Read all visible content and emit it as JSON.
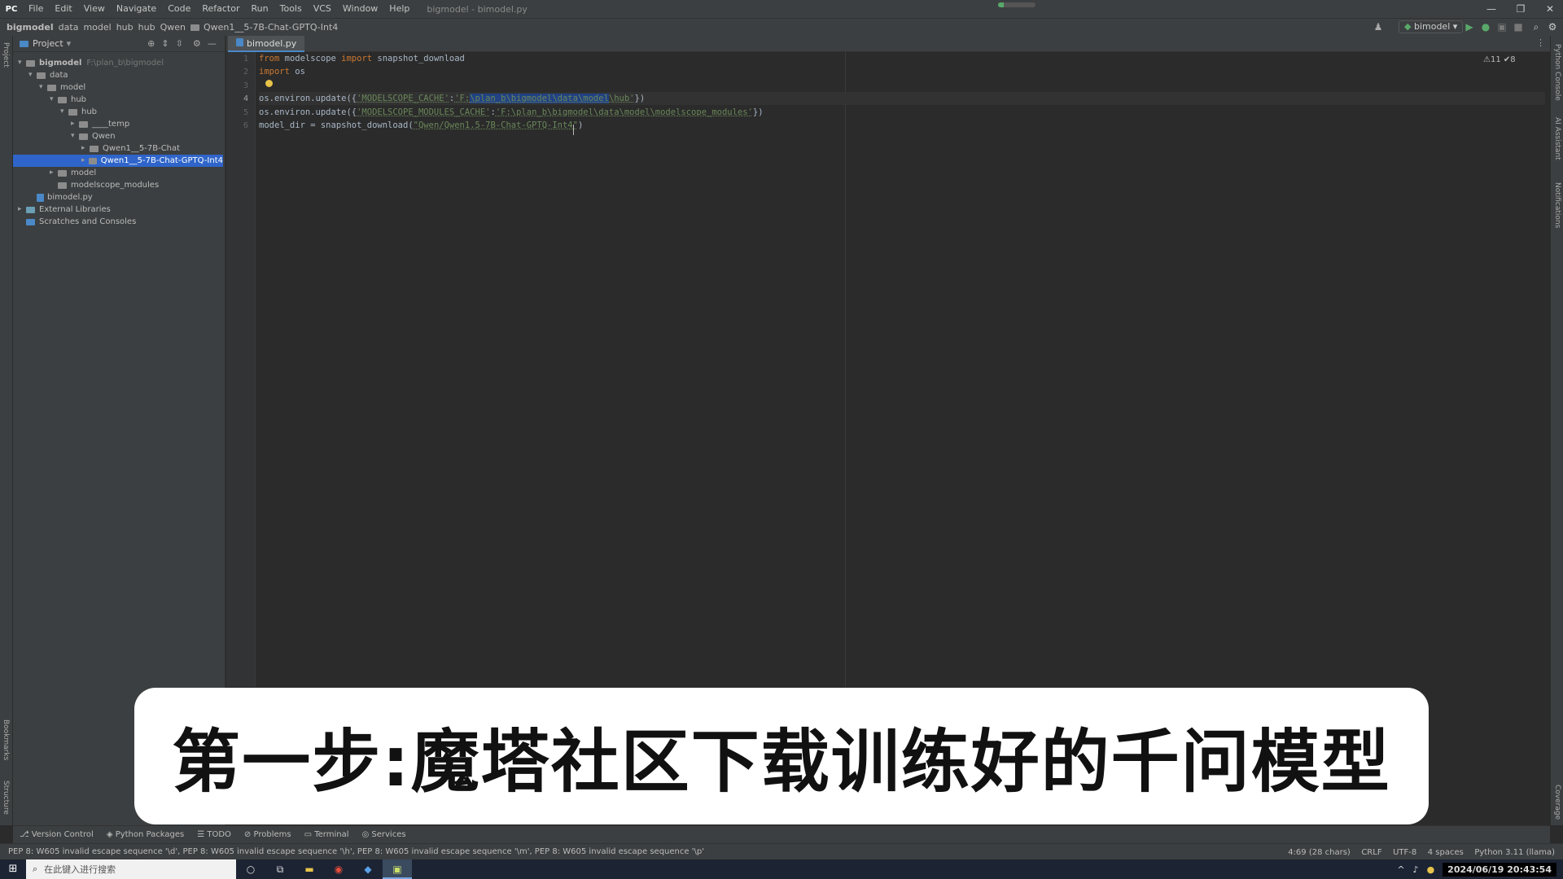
{
  "window": {
    "app_icon": "pycharm-icon",
    "menu": [
      "File",
      "Edit",
      "View",
      "Navigate",
      "Code",
      "Refactor",
      "Run",
      "Tools",
      "VCS",
      "Window",
      "Help"
    ],
    "title": "bigmodel - bimodel.py",
    "progress_fraction": 0.15,
    "controls": [
      "—",
      "❐",
      "✕"
    ]
  },
  "navbar": {
    "breadcrumb": [
      "bigmodel",
      "data",
      "model",
      "hub",
      "hub",
      "Qwen",
      "Qwen1__5-7B-Chat-GPTQ-Int4"
    ],
    "run_config": "bimodel"
  },
  "left_strip": {
    "top": [
      "Project"
    ],
    "bottom": [
      "Bookmarks",
      "Structure"
    ]
  },
  "right_strip": {
    "top": [
      "Python Console",
      "AI Assistant",
      "Notifications"
    ],
    "bottom": [
      "Coverage"
    ]
  },
  "project": {
    "header": "Project",
    "tree": [
      {
        "indent": 0,
        "chev": "v",
        "icon": "folder",
        "label": "bigmodel",
        "note": "F:\\plan_b\\bigmodel",
        "bold": true
      },
      {
        "indent": 1,
        "chev": "v",
        "icon": "folder",
        "label": "data"
      },
      {
        "indent": 2,
        "chev": "v",
        "icon": "folder",
        "label": "model"
      },
      {
        "indent": 3,
        "chev": "v",
        "icon": "folder",
        "label": "hub"
      },
      {
        "indent": 4,
        "chev": "v",
        "icon": "folder",
        "label": "hub"
      },
      {
        "indent": 5,
        "chev": ">",
        "icon": "folder",
        "label": "____temp"
      },
      {
        "indent": 5,
        "chev": "v",
        "icon": "folder",
        "label": "Qwen"
      },
      {
        "indent": 6,
        "chev": ">",
        "icon": "folder",
        "label": "Qwen1__5-7B-Chat"
      },
      {
        "indent": 6,
        "chev": ">",
        "icon": "folder",
        "label": "Qwen1__5-7B-Chat-GPTQ-Int4",
        "selected": true
      },
      {
        "indent": 3,
        "chev": ">",
        "icon": "folder",
        "label": "model"
      },
      {
        "indent": 3,
        "chev": "",
        "icon": "folder",
        "label": "modelscope_modules"
      },
      {
        "indent": 1,
        "chev": "",
        "icon": "py",
        "label": "bimodel.py"
      },
      {
        "indent": 0,
        "chev": ">",
        "icon": "lib",
        "label": "External Libraries"
      },
      {
        "indent": 0,
        "chev": "",
        "icon": "scratch",
        "label": "Scratches and Consoles"
      }
    ]
  },
  "editor": {
    "tab": "bimodel.py",
    "line_numbers": [
      "1",
      "2",
      "3",
      "4",
      "5",
      "6"
    ],
    "inspections": "⚠11 ✔8",
    "code": {
      "l1_kw1": "from",
      "l1_mod": " modelscope ",
      "l1_kw2": "import",
      "l1_rest": " snapshot_download",
      "l2_kw": "import",
      "l2_rest": " os",
      "l4_pre": "os.environ.update({",
      "l4_key": "'MODELSCOPE_CACHE'",
      "l4_colon": ":",
      "l4_val_a": "'F:",
      "l4_val_sel": "\\plan_b\\bigmodel\\data\\model",
      "l4_val_b": "\\hub'",
      "l4_post": "})",
      "l5_pre": "os.environ.update({",
      "l5_key": "'MODELSCOPE_MODULES_CACHE'",
      "l5_colon": ":",
      "l5_val": "'F:\\plan_b\\bigmodel\\data\\model\\modelscope_modules'",
      "l5_post": "})",
      "l6_pre": "model_dir = snapshot_download(",
      "l6_str": "\"Qwen/Qwen1.5-7B-Chat-GPTQ-Int4\"",
      "l6_post": ")"
    }
  },
  "subtitle": "第一步:魔塔社区下载训练好的千问模型",
  "tool_windows": [
    "Version Control",
    "Python Packages",
    "TODO",
    "Problems",
    "Terminal",
    "Services"
  ],
  "status": {
    "message": "PEP 8: W605 invalid escape sequence '\\d', PEP 8: W605 invalid escape sequence '\\h', PEP 8: W605 invalid escape sequence '\\m', PEP 8: W605 invalid escape sequence '\\p'",
    "position": "4:69 (28 chars)",
    "line_sep": "CRLF",
    "encoding": "UTF-8",
    "indent": "4 spaces",
    "interpreter": "Python 3.11 (llama)"
  },
  "taskbar": {
    "search_placeholder": "在此键入进行搜索",
    "datetime": "2024/06/19 20:43:54"
  }
}
